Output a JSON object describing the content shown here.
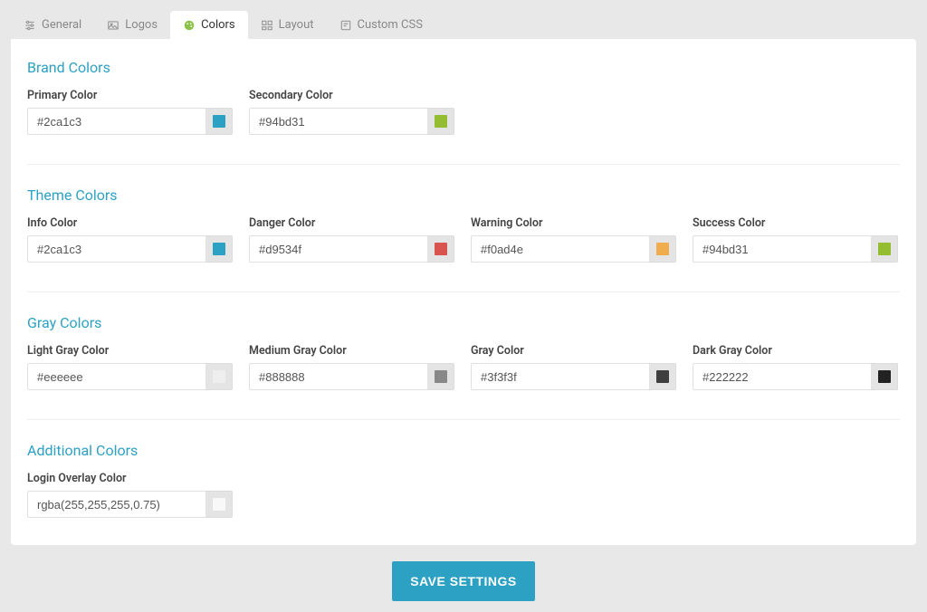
{
  "tabs": {
    "general": "General",
    "logos": "Logos",
    "colors": "Colors",
    "layout": "Layout",
    "custom_css": "Custom CSS"
  },
  "sections": {
    "brand": {
      "title": "Brand Colors",
      "primary": {
        "label": "Primary Color",
        "value": "#2ca1c3",
        "swatch": "#2ca1c3"
      },
      "secondary": {
        "label": "Secondary Color",
        "value": "#94bd31",
        "swatch": "#94bd31"
      }
    },
    "theme": {
      "title": "Theme Colors",
      "info": {
        "label": "Info Color",
        "value": "#2ca1c3",
        "swatch": "#2ca1c3"
      },
      "danger": {
        "label": "Danger Color",
        "value": "#d9534f",
        "swatch": "#d9534f"
      },
      "warning": {
        "label": "Warning Color",
        "value": "#f0ad4e",
        "swatch": "#f0ad4e"
      },
      "success": {
        "label": "Success Color",
        "value": "#94bd31",
        "swatch": "#94bd31"
      }
    },
    "gray": {
      "title": "Gray Colors",
      "light": {
        "label": "Light Gray Color",
        "value": "#eeeeee",
        "swatch": "#eeeeee"
      },
      "medium": {
        "label": "Medium Gray Color",
        "value": "#888888",
        "swatch": "#888888"
      },
      "gray": {
        "label": "Gray Color",
        "value": "#3f3f3f",
        "swatch": "#3f3f3f"
      },
      "dark": {
        "label": "Dark Gray Color",
        "value": "#222222",
        "swatch": "#222222"
      }
    },
    "additional": {
      "title": "Additional Colors",
      "login_overlay": {
        "label": "Login Overlay Color",
        "value": "rgba(255,255,255,0.75)",
        "swatch": "rgba(255,255,255,0.75)"
      }
    }
  },
  "actions": {
    "save": "SAVE SETTINGS"
  }
}
